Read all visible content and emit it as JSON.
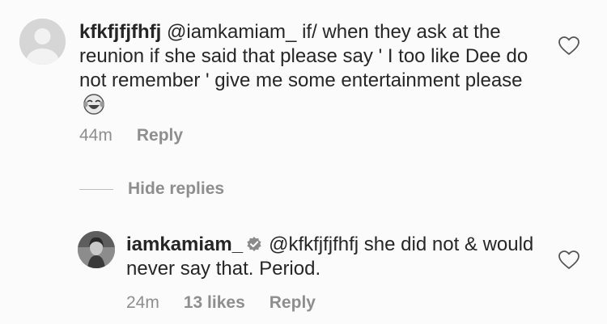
{
  "comments": [
    {
      "username": "kfkfjfjfhfj",
      "text": "@iamkamiam_  if/ when they ask at the reunion if she said that please say ' I too like Dee do not remember ' give me some entertainment please",
      "emoji_icon": "face-with-tears-of-joy-icon",
      "time": "44m",
      "reply_label": "Reply",
      "avatar_icon": "default-avatar-icon"
    }
  ],
  "hide_replies_label": "Hide replies",
  "replies": [
    {
      "username": "iamkamiam_",
      "verified": true,
      "text": "@kfkfjfjfhfj she did not & would never say that. Period.",
      "time": "24m",
      "likes": "13 likes",
      "reply_label": "Reply",
      "avatar_icon": "profile-photo-avatar"
    }
  ],
  "colors": {
    "text": "#262626",
    "meta": "#8e8e8e",
    "divider": "#bdbdbd"
  }
}
